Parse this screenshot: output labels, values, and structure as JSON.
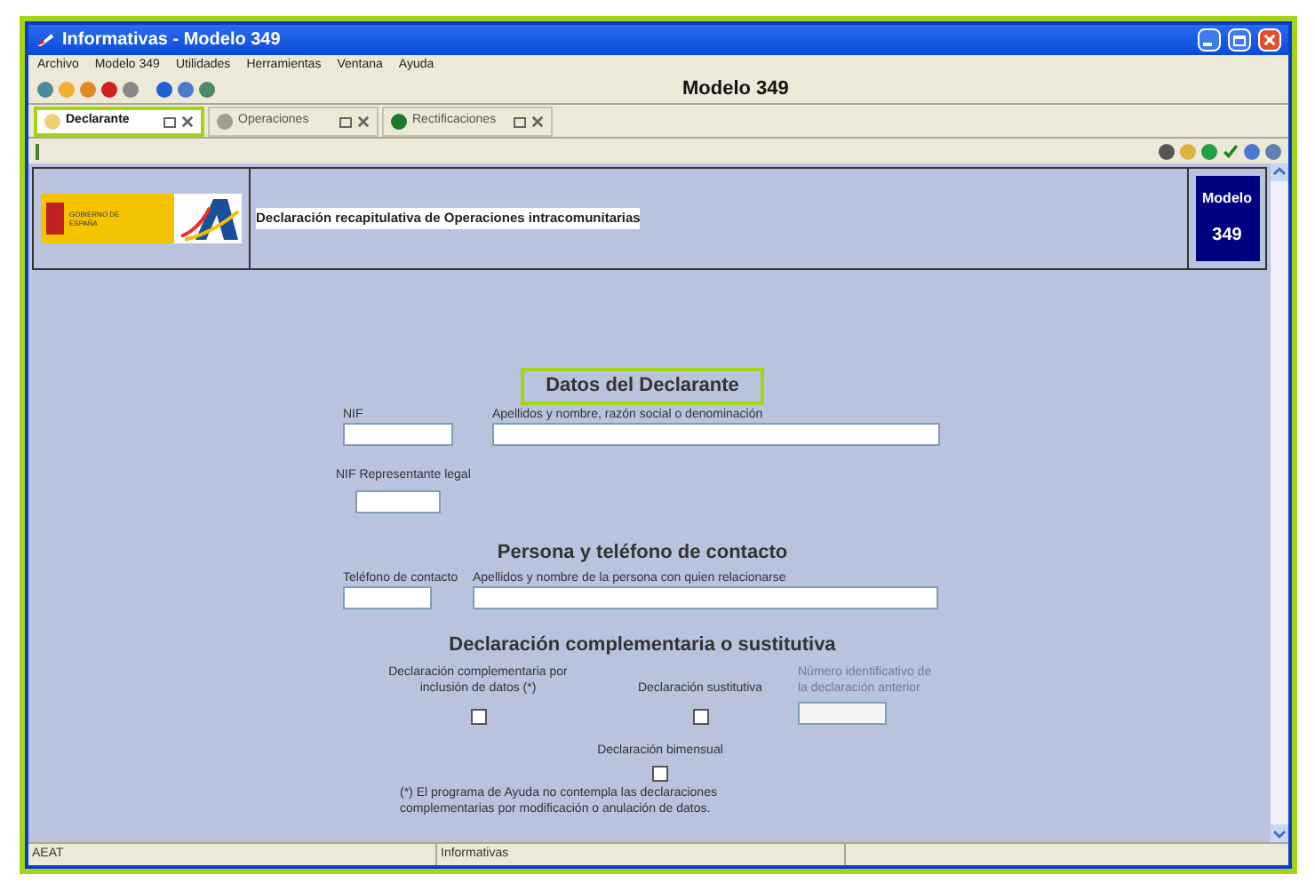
{
  "window": {
    "title": "Informativas - Modelo 349"
  },
  "menu": [
    "Archivo",
    "Modelo 349",
    "Utilidades",
    "Herramientas",
    "Ventana",
    "Ayuda"
  ],
  "toolbar": {
    "title": "Modelo 349"
  },
  "tabs": [
    {
      "label": "Declarante",
      "selected": true,
      "highlighted": true
    },
    {
      "label": "Operaciones",
      "selected": false,
      "highlighted": false
    },
    {
      "label": "Rectificaciones",
      "selected": false,
      "highlighted": false
    }
  ],
  "header": {
    "logo_text": "GOBIERNO DE ESPAÑA",
    "description": "Declaración recapitulativa de Operaciones intracomunitarias",
    "badge": [
      "Modelo",
      "349"
    ]
  },
  "sections": [
    {
      "title": "Datos del Declarante",
      "highlighted": true,
      "fields": [
        {
          "label": "NIF"
        },
        {
          "label": "Apellidos y nombre,  razón social o denominación"
        },
        {
          "label": "NIF Representante legal"
        }
      ]
    },
    {
      "title": "Persona y teléfono de contacto",
      "highlighted": false,
      "fields": [
        {
          "label": "Teléfono de contacto"
        },
        {
          "label": "Apellidos y nombre de la persona con quien relacionarse"
        }
      ]
    },
    {
      "title": "Declaración complementaria o sustitutiva",
      "highlighted": false,
      "fields": [
        {
          "kind": "checkbox",
          "label": "Declaración complementaria por inclusión de datos (*)",
          "checked": false
        },
        {
          "kind": "checkbox",
          "label": "Declaración sustitutiva",
          "checked": false
        },
        {
          "kind": "text",
          "label": "Número identificativo de la declaración anterior",
          "disabled": true
        },
        {
          "kind": "checkbox",
          "label": "Declaración bimensual",
          "checked": false
        }
      ],
      "note": "(*) El programa de Ayuda no contempla las declaraciones complementarias por modificación o anulación de datos."
    }
  ],
  "status_bar": [
    "AEAT",
    "Informativas"
  ]
}
